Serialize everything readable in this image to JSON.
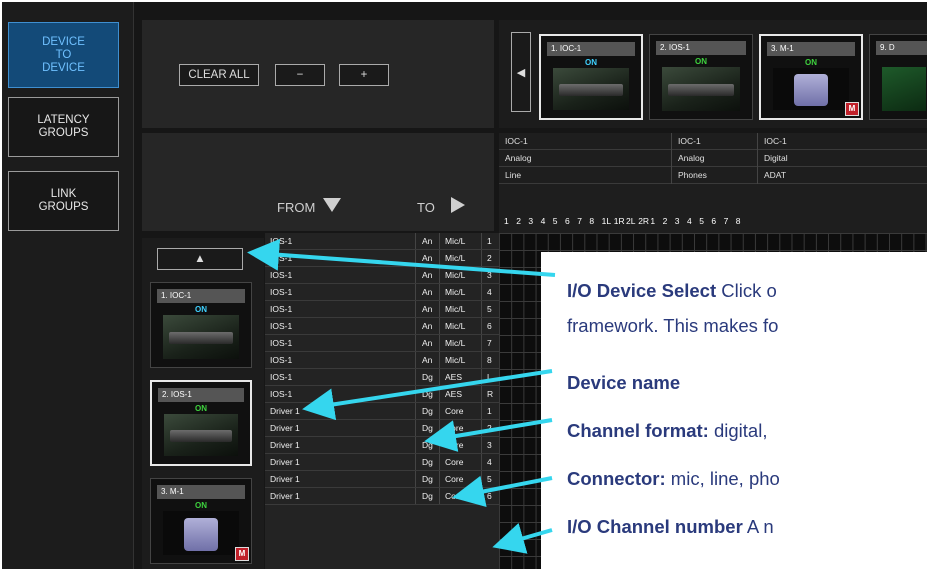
{
  "nav": {
    "items": [
      {
        "label_lines": [
          "DEVICE",
          "TO",
          "DEVICE"
        ],
        "active": true
      },
      {
        "label_lines": [
          "LATENCY",
          "GROUPS"
        ],
        "active": false
      },
      {
        "label_lines": [
          "LINK",
          "GROUPS"
        ],
        "active": false
      }
    ]
  },
  "controls": {
    "clear_all": "CLEAR ALL",
    "minus": "−",
    "plus": "+",
    "from_label": "FROM",
    "to_label": "TO"
  },
  "top_devices": [
    {
      "title": "1. IOC-1",
      "status": "ON",
      "status_color": "#3fd2ff",
      "selected": true,
      "badge": ""
    },
    {
      "title": "2. IOS-1",
      "status": "ON",
      "status_color": "#3ed23e",
      "selected": false,
      "badge": ""
    },
    {
      "title": "3. M-1",
      "status": "ON",
      "status_color": "#3ed23e",
      "selected": true,
      "badge": "M"
    },
    {
      "title": "9. D",
      "status": "",
      "status_color": "#3ed23e",
      "selected": false,
      "badge": ""
    }
  ],
  "side_devices": [
    {
      "title": "1. IOC-1",
      "status": "ON",
      "status_color": "#3fd2ff",
      "selected": false,
      "badge": ""
    },
    {
      "title": "2. IOS-1",
      "status": "ON",
      "status_color": "#3ed23e",
      "selected": true,
      "badge": ""
    },
    {
      "title": "3. M-1",
      "status": "ON",
      "status_color": "#3ed23e",
      "selected": false,
      "badge": "M"
    }
  ],
  "column_groups": [
    {
      "device": "IOC-1",
      "format": "Analog",
      "connector": "Line",
      "channels": [
        "1",
        "2",
        "3",
        "4",
        "5",
        "6",
        "7",
        "8"
      ]
    },
    {
      "device": "IOC-1",
      "format": "Analog",
      "connector": "Phones",
      "channels": [
        "1L",
        "1R",
        "2L",
        "2R"
      ]
    },
    {
      "device": "IOC-1",
      "format": "Digital",
      "connector": "ADAT",
      "channels": [
        "1",
        "2",
        "3",
        "4",
        "5",
        "6",
        "7",
        "8"
      ]
    }
  ],
  "rows": [
    {
      "device": "IOS-1",
      "format": "An",
      "connector": "Mic/L",
      "channel": "1"
    },
    {
      "device": "IOS-1",
      "format": "An",
      "connector": "Mic/L",
      "channel": "2"
    },
    {
      "device": "IOS-1",
      "format": "An",
      "connector": "Mic/L",
      "channel": "3"
    },
    {
      "device": "IOS-1",
      "format": "An",
      "connector": "Mic/L",
      "channel": "4"
    },
    {
      "device": "IOS-1",
      "format": "An",
      "connector": "Mic/L",
      "channel": "5"
    },
    {
      "device": "IOS-1",
      "format": "An",
      "connector": "Mic/L",
      "channel": "6"
    },
    {
      "device": "IOS-1",
      "format": "An",
      "connector": "Mic/L",
      "channel": "7"
    },
    {
      "device": "IOS-1",
      "format": "An",
      "connector": "Mic/L",
      "channel": "8"
    },
    {
      "device": "IOS-1",
      "format": "Dg",
      "connector": "AES",
      "channel": "L"
    },
    {
      "device": "IOS-1",
      "format": "Dg",
      "connector": "AES",
      "channel": "R"
    },
    {
      "device": "Driver 1",
      "format": "Dg",
      "connector": "Core",
      "channel": "1"
    },
    {
      "device": "Driver 1",
      "format": "Dg",
      "connector": "Core",
      "channel": "2"
    },
    {
      "device": "Driver 1",
      "format": "Dg",
      "connector": "Core",
      "channel": "3"
    },
    {
      "device": "Driver 1",
      "format": "Dg",
      "connector": "Core",
      "channel": "4"
    },
    {
      "device": "Driver 1",
      "format": "Dg",
      "connector": "Core",
      "channel": "5"
    },
    {
      "device": "Driver 1",
      "format": "Dg",
      "connector": "Core",
      "channel": "6"
    }
  ],
  "callouts": [
    {
      "bold": "I/O Device Select",
      "rest": " Click o"
    },
    {
      "bold": "",
      "rest": "framework. This makes fo"
    },
    {
      "bold": "Device name",
      "rest": ""
    },
    {
      "bold": "Channel format:",
      "rest": " digital,"
    },
    {
      "bold": "Connector:",
      "rest": " mic, line, pho"
    },
    {
      "bold": "I/O Channel number",
      "rest": " A n"
    }
  ],
  "colors": {
    "arrow": "#35d6ee",
    "callout_text": "#2a3a7c",
    "active_nav": "#134a78"
  }
}
